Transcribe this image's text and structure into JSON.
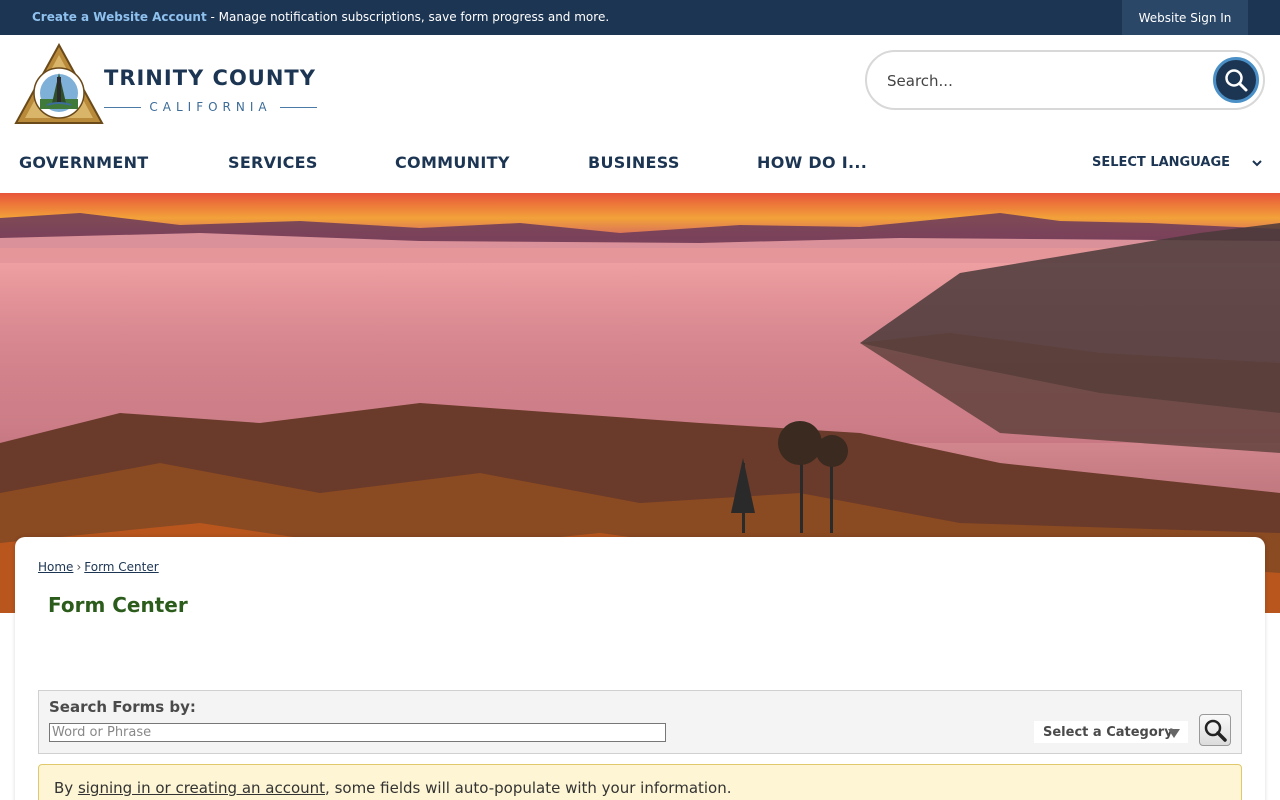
{
  "topbar": {
    "create_account_link": "Create a Website Account",
    "promo_text": " - Manage notification subscriptions, save form progress and more.",
    "sign_in": "Website Sign In"
  },
  "logo": {
    "name": "TRINITY COUNTY",
    "subtitle": "CALIFORNIA"
  },
  "search": {
    "placeholder": "Search..."
  },
  "nav": {
    "items": [
      "GOVERNMENT",
      "SERVICES",
      "COMMUNITY",
      "BUSINESS",
      "HOW DO I..."
    ],
    "language": "SELECT LANGUAGE"
  },
  "breadcrumb": {
    "home": "Home",
    "separator": "›",
    "current": "Form Center"
  },
  "page": {
    "title": "Form Center"
  },
  "form_search": {
    "label": "Search Forms by:",
    "input_placeholder": "Word or Phrase",
    "category_select": "Select a Category"
  },
  "notice": {
    "prefix": "By ",
    "link": "signing in or creating an account",
    "suffix": ", some fields will auto-populate with your information."
  },
  "colors": {
    "navy": "#1c3553",
    "title_green": "#2b5c1b",
    "notice_bg": "#fdf5d3"
  }
}
